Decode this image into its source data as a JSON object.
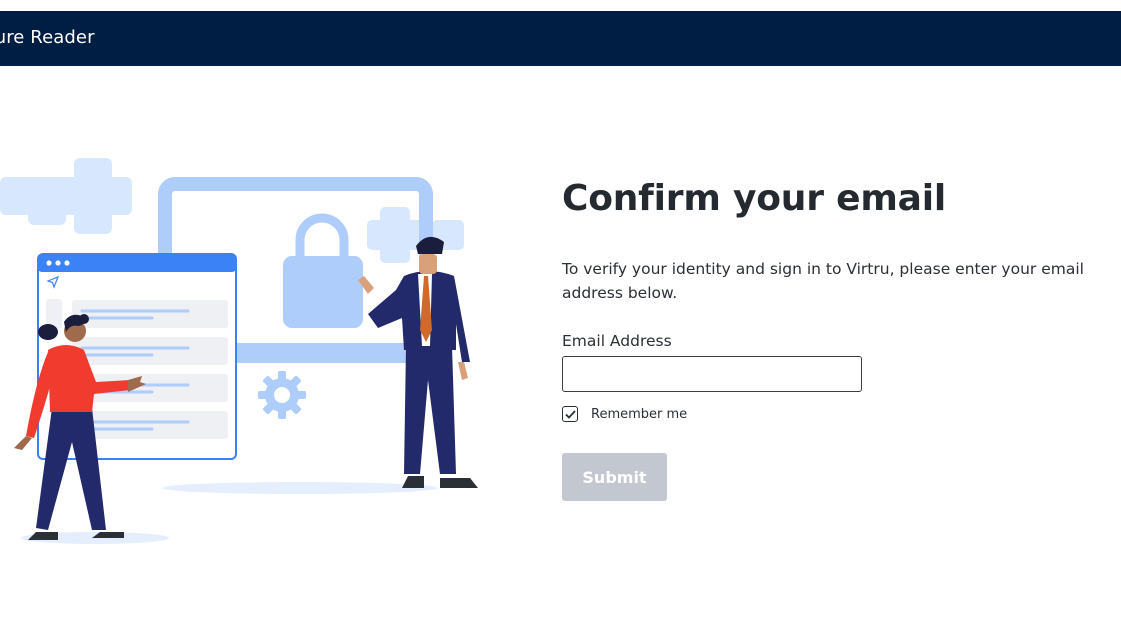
{
  "header": {
    "title": "Secure Reader"
  },
  "main": {
    "title": "Confirm your email",
    "instructions": "To verify your identity and sign in to Virtru, please enter your email address below.",
    "email_label": "Email Address",
    "email_value": "",
    "remember_label": "Remember me",
    "remember_checked": true,
    "submit_label": "Submit"
  },
  "colors": {
    "header_bg": "#001d44",
    "submit_disabled_bg": "#c3c7d0",
    "illustration_light_blue": "#aecdfb",
    "illustration_accent_blue": "#3b82f6"
  }
}
